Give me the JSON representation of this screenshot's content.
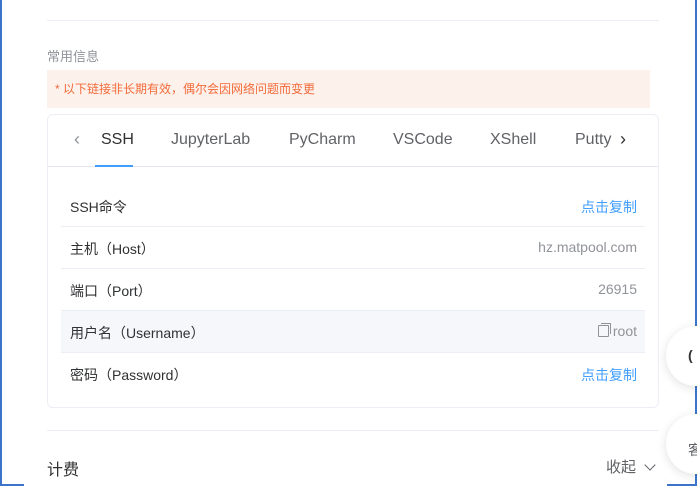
{
  "section_title": "常用信息",
  "notice": "* 以下链接非长期有效，偶尔会因网络问题而变更",
  "tabs": [
    {
      "label": "SSH",
      "active": true
    },
    {
      "label": "JupyterLab",
      "active": false
    },
    {
      "label": "PyCharm",
      "active": false
    },
    {
      "label": "VSCode",
      "active": false
    },
    {
      "label": "XShell",
      "active": false
    },
    {
      "label": "Putty",
      "active": false
    }
  ],
  "tab_nav": {
    "prev": "‹",
    "next": "›"
  },
  "rows": [
    {
      "label": "SSH命令",
      "value": "点击复制",
      "link": true
    },
    {
      "label": "主机（Host）",
      "value": "hz.matpool.com",
      "link": false
    },
    {
      "label": "端口（Port）",
      "value": "26915",
      "link": false
    },
    {
      "label": "用户名（Username）",
      "value": "root",
      "link": false,
      "copy_icon": "copy-icon"
    },
    {
      "label": "密码（Password）",
      "value": "点击复制",
      "link": true
    }
  ],
  "billing": {
    "title": "计费",
    "collapse_label": "收起"
  },
  "floating": {
    "partial_text_1": "(",
    "partial_text_2": "客"
  },
  "colors": {
    "accent": "#409eff",
    "notice_bg": "#fdf1ec",
    "notice_text": "#f26b3a",
    "frame": "#3b74c9"
  }
}
